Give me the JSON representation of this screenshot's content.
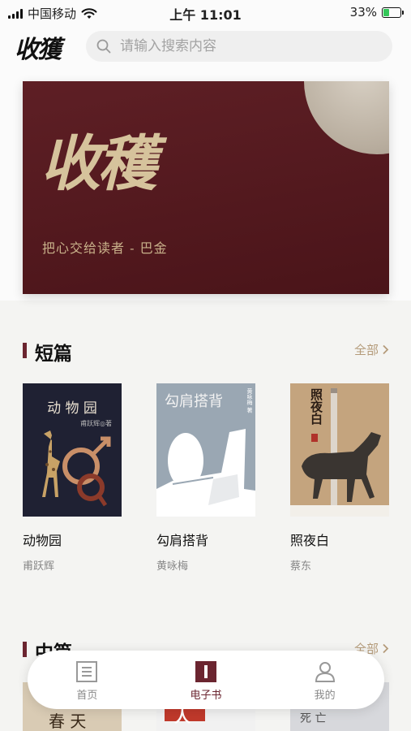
{
  "status_bar": {
    "carrier": "中国移动",
    "time": "上午 11:01",
    "battery": "33%"
  },
  "header": {
    "logo_text": "收獲",
    "search_placeholder": "请输入搜索内容"
  },
  "banner": {
    "title": "收穫",
    "quote": "把心交给读者 - 巴金"
  },
  "sections": [
    {
      "title": "短篇",
      "all_label": "全部",
      "books": [
        {
          "name": "动物园",
          "author": "甫跃辉",
          "cover_title": "动 物 园",
          "cover_author": "甫跃辉◎著"
        },
        {
          "name": "勾肩搭背",
          "author": "黄咏梅",
          "cover_title": "勾肩搭背",
          "cover_author": "黄咏梅 著"
        },
        {
          "name": "照夜白",
          "author": "蔡东",
          "cover_title": "照夜白"
        }
      ]
    },
    {
      "title": "中篇",
      "all_label": "全部",
      "book_covers": [
        "春 天",
        "人",
        "死 亡"
      ]
    }
  ],
  "tabbar": {
    "items": [
      {
        "label": "首页",
        "active": false
      },
      {
        "label": "电子书",
        "active": true
      },
      {
        "label": "我的",
        "active": false
      }
    ]
  },
  "colors": {
    "accent": "#6b2530",
    "banner_bg": "#5a1b21",
    "banner_text": "#d6c39c",
    "link": "#b49b7a"
  }
}
